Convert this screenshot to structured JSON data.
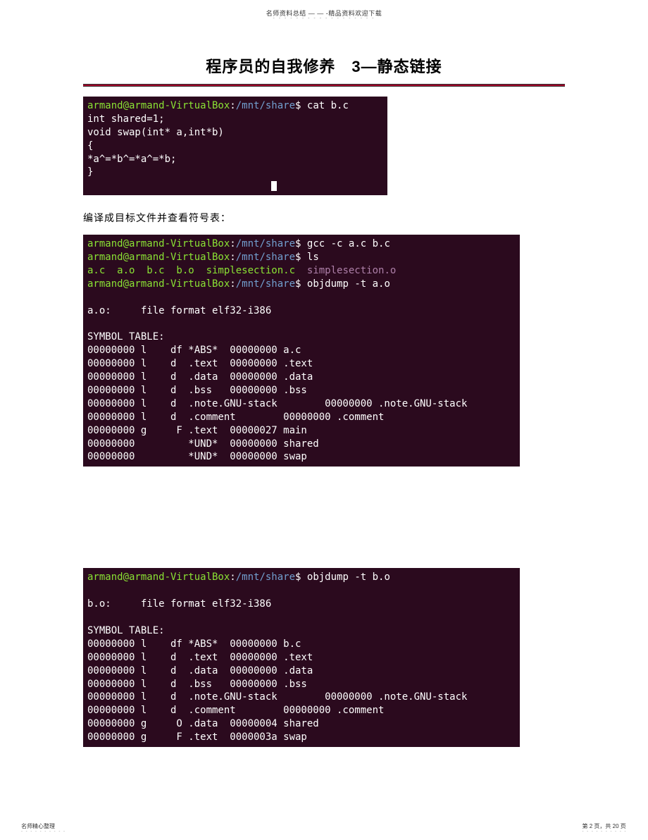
{
  "header": {
    "note": "名师资料总结 — — -精品资料欢迎下载",
    "dots": "- - - - - - - - - - - - - - - - - -"
  },
  "title": "程序员的自我修养　3—静态链接",
  "terminal1": {
    "prompt_user": "armand@armand-VirtualBox",
    "prompt_sep1": ":",
    "prompt_path": "/mnt/share",
    "prompt_sep2": "$",
    "cmd": " cat b.c",
    "line1": "int shared=1;",
    "line2": "void swap(int* a,int*b)",
    "line3": "{",
    "line4": "*a^=*b^=*a^=*b;",
    "line5": "}"
  },
  "para1": "编译成目标文件并查看符号表：",
  "terminal2": {
    "l1_cmd": " gcc -c a.c b.c",
    "l2_cmd": " ls",
    "l3_files_a": "a.c  a.o  b.c  b.o  simplesection.c",
    "l3_files_b": "  simplesection.o",
    "l4_cmd": " objdump -t a.o",
    "l6": "a.o:     file format elf32-i386",
    "l8": "SYMBOL TABLE:",
    "l9": "00000000 l    df *ABS*  00000000 a.c",
    "l10": "00000000 l    d  .text  00000000 .text",
    "l11": "00000000 l    d  .data  00000000 .data",
    "l12": "00000000 l    d  .bss   00000000 .bss",
    "l13": "00000000 l    d  .note.GNU-stack        00000000 .note.GNU-stack",
    "l14": "00000000 l    d  .comment        00000000 .comment",
    "l15": "00000000 g     F .text  00000027 main",
    "l16": "00000000         *UND*  00000000 shared",
    "l17": "00000000         *UND*  00000000 swap"
  },
  "terminal3": {
    "l1_cmd": " objdump -t b.o",
    "l3": "b.o:     file format elf32-i386",
    "l5": "SYMBOL TABLE:",
    "l6": "00000000 l    df *ABS*  00000000 b.c",
    "l7": "00000000 l    d  .text  00000000 .text",
    "l8": "00000000 l    d  .data  00000000 .data",
    "l9": "00000000 l    d  .bss   00000000 .bss",
    "l10": "00000000 l    d  .note.GNU-stack        00000000 .note.GNU-stack",
    "l11": "00000000 l    d  .comment        00000000 .comment",
    "l12": "00000000 g     O .data  00000004 shared",
    "l13": "00000000 g     F .text  0000003a swap"
  },
  "footer": {
    "left": "名师精心整理",
    "right": "第 2 页，共 20 页",
    "dots": "- - - - - - - - - -"
  }
}
